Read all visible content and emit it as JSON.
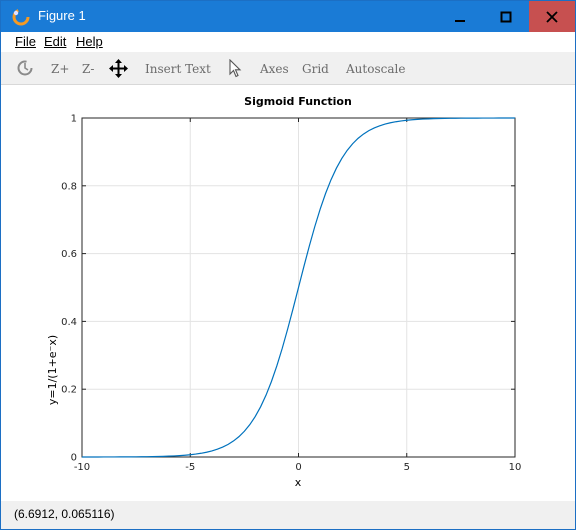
{
  "window": {
    "title": "Figure 1"
  },
  "menu": {
    "items": [
      {
        "label": "File"
      },
      {
        "label": "Edit"
      },
      {
        "label": "Help"
      }
    ]
  },
  "toolbar": {
    "rotate_icon": "rotate-icon",
    "zoom_in": "Z+",
    "zoom_out": "Z-",
    "pan_icon": "pan-icon",
    "insert_text": "Insert Text",
    "select_icon": "cursor-icon",
    "axes": "Axes",
    "grid": "Grid",
    "autoscale": "Autoscale"
  },
  "status": {
    "coords": "(6.6912, 0.065116)"
  },
  "colors": {
    "titlebar": "#1a7bd6",
    "close": "#c75050",
    "line": "#0072bd"
  },
  "chart_data": {
    "type": "line",
    "title": "Sigmoid Function",
    "xlabel": "x",
    "ylabel": "y=1/(1+e⁻x)",
    "xlim": [
      -10,
      10
    ],
    "ylim": [
      0,
      1
    ],
    "xticks": [
      -10,
      -5,
      0,
      5,
      10
    ],
    "yticks": [
      0,
      0.2,
      0.4,
      0.6,
      0.8,
      1
    ],
    "ytick_labels": [
      "0",
      "0.2",
      "0.4",
      "0.6",
      "0.8",
      "1"
    ],
    "grid": true,
    "function": "sigmoid",
    "series": [
      {
        "x_start": -10,
        "x_end": 10,
        "x_step": 0.25
      }
    ]
  }
}
